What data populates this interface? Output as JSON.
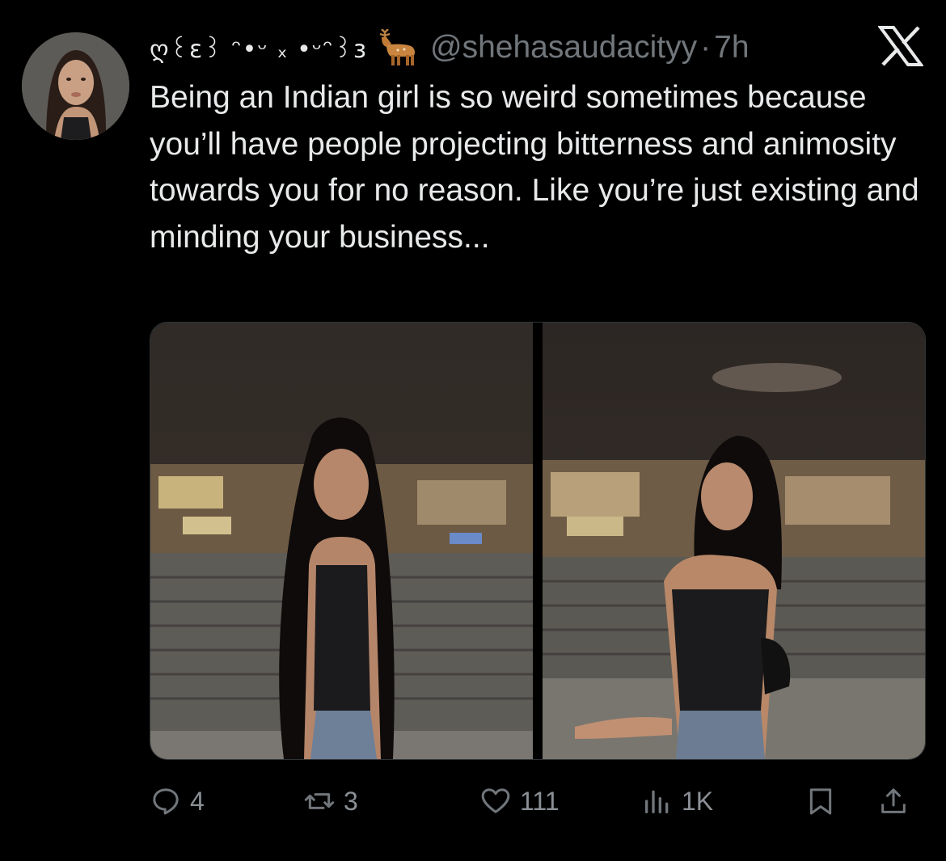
{
  "tweet": {
    "display_name": "ღ꒰ɛ꒱ ᵔ•ᵕ ₓ •ᵕᵔ꒱ɜ",
    "handle": "@shehasaudacityy",
    "separator": "·",
    "time": "7h",
    "text": "Being an Indian girl is so weird sometimes because you’ll have people projecting bitterness and animosity towards you for no reason. Like you’re just existing and minding your business...",
    "images": [
      {
        "name": "photo-1",
        "icon": "person-photo"
      },
      {
        "name": "photo-2",
        "icon": "person-photo"
      }
    ]
  },
  "actions": {
    "reply_count": "4",
    "retweet_count": "3",
    "like_count": "111",
    "views_count": "1K"
  },
  "icons": [
    "x-logo-icon",
    "deer-emoji-icon",
    "reply-icon",
    "retweet-icon",
    "like-icon",
    "views-icon",
    "bookmark-icon",
    "share-icon"
  ],
  "colors": {
    "background": "#000000",
    "text": "#e7e9ea",
    "muted": "#71767b"
  }
}
